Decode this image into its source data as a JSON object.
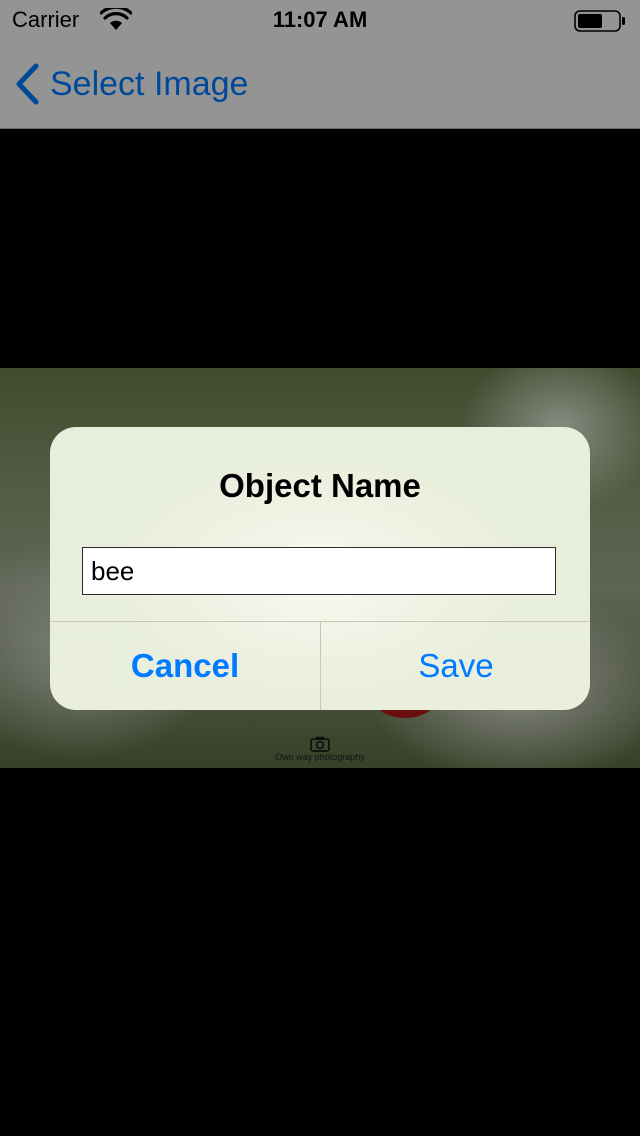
{
  "status_bar": {
    "carrier": "Carrier",
    "time": "11:07 AM",
    "wifi_icon": "wifi-icon",
    "battery_icon": "battery-icon"
  },
  "nav_bar": {
    "back_label": "Select Image",
    "back_icon": "chevron-left-icon"
  },
  "photo": {
    "watermark": "Own way photography",
    "camera_icon": "camera-icon"
  },
  "alert": {
    "title": "Object Name",
    "input_value": "bee",
    "cancel_label": "Cancel",
    "save_label": "Save"
  },
  "colors": {
    "accent": "#007aff",
    "background": "#000000",
    "bar_background": "#f7f7f7"
  }
}
